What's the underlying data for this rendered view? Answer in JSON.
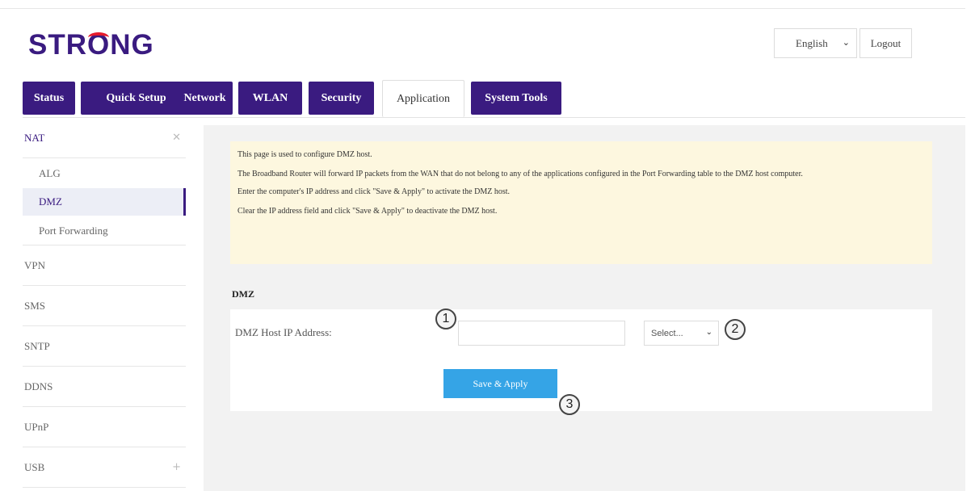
{
  "header": {
    "logo_text_before": "STR",
    "logo_text_o": "O",
    "logo_text_after": "NG",
    "language": "English",
    "logout_label": "Logout"
  },
  "tabs": [
    {
      "label": "Status"
    },
    {
      "label": "Quick Setup"
    },
    {
      "label": "Network"
    },
    {
      "label": "WLAN"
    },
    {
      "label": "Security"
    },
    {
      "label": "Application"
    },
    {
      "label": "System Tools"
    }
  ],
  "active_tab": "Application",
  "sidebar": {
    "items": [
      {
        "label": "NAT"
      },
      {
        "label": "ALG"
      },
      {
        "label": "DMZ"
      },
      {
        "label": "Port Forwarding"
      },
      {
        "label": "VPN"
      },
      {
        "label": "SMS"
      },
      {
        "label": "SNTP"
      },
      {
        "label": "DDNS"
      },
      {
        "label": "UPnP"
      },
      {
        "label": "USB"
      }
    ],
    "active_item": "DMZ",
    "collapse_icon": "close-icon",
    "expand_icon": "plus-icon"
  },
  "info": {
    "line1": "This page is used to configure DMZ host.",
    "line2": "The Broadband Router will forward IP packets from the WAN that do not belong to any of the applications configured in the Port Forwarding table to the DMZ host computer.",
    "line3": "Enter the computer's IP address and click \"Save & Apply\" to activate the DMZ host.",
    "line4": "Clear the IP address field and click \"Save & Apply\" to deactivate the DMZ host."
  },
  "dmz": {
    "section_title": "DMZ",
    "ip_label": "DMZ Host IP Address:",
    "ip_value": "",
    "select_value": "Select...",
    "save_label": "Save & Apply"
  },
  "callouts": [
    "1",
    "2",
    "3"
  ],
  "colors": {
    "brand_purple": "#3a1b80",
    "logo_red": "#e61b2d",
    "button_blue": "#35a4e6",
    "info_bg": "#fdf7df"
  }
}
